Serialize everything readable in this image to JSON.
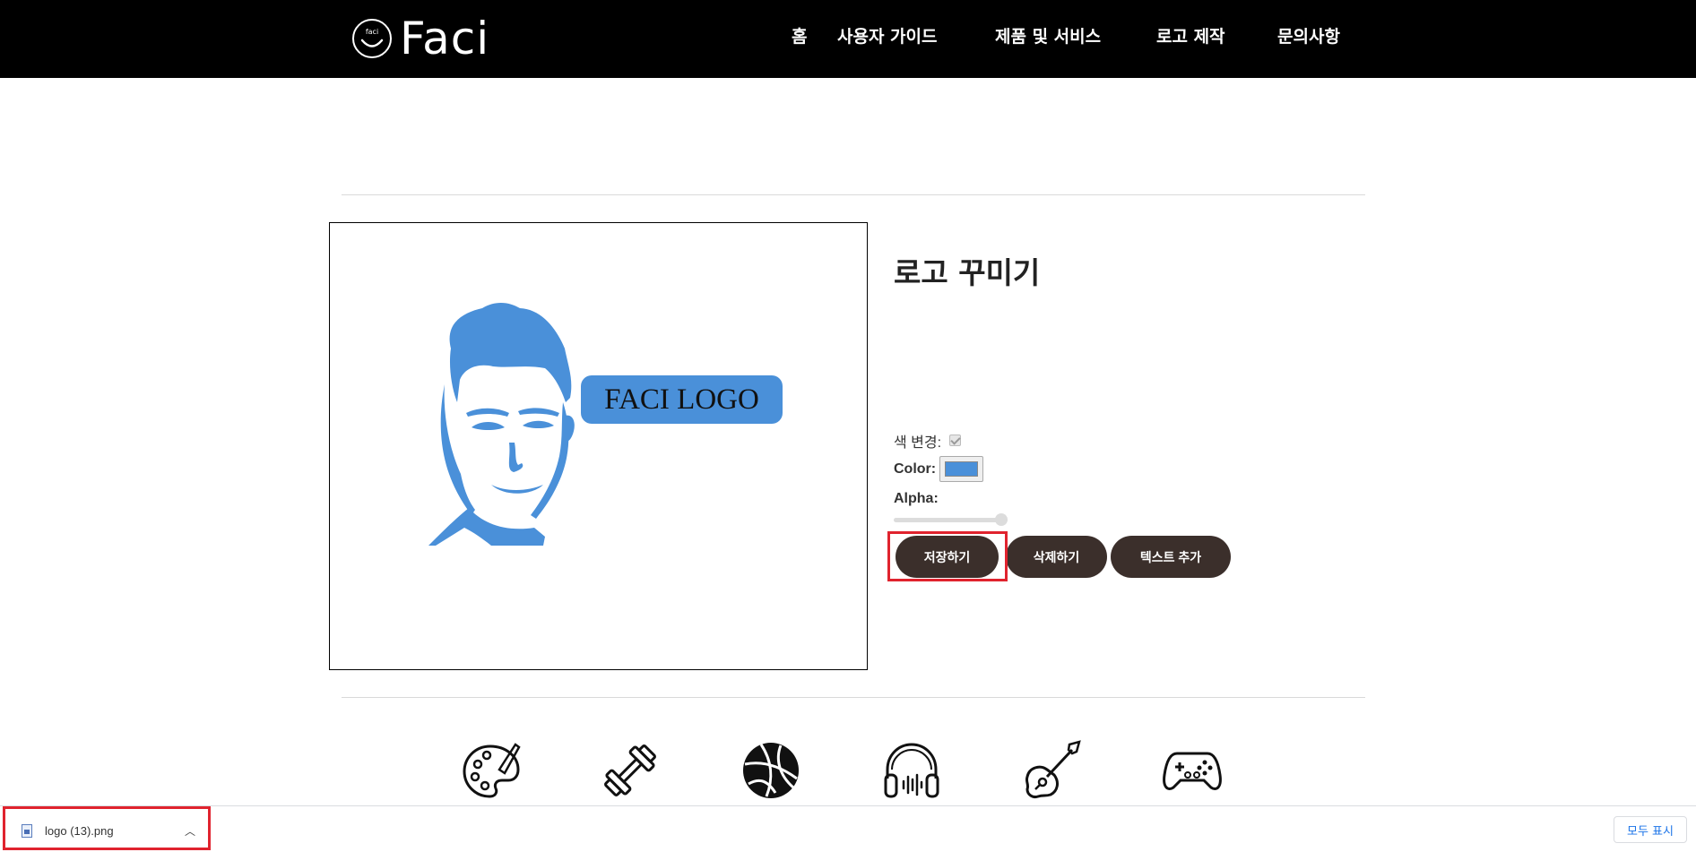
{
  "header": {
    "brand": "Faci",
    "nav": [
      {
        "label": "홈"
      },
      {
        "label": "사용자 가이드"
      },
      {
        "label": "제품 및 서비스"
      },
      {
        "label": "로고 제작"
      },
      {
        "label": "문의사항"
      }
    ]
  },
  "canvas": {
    "bubble_text": "FACI LOGO",
    "logo_color": "#4a90d9"
  },
  "panel": {
    "title": "로고 꾸미기",
    "color_change_label": "색 변경:",
    "color_change_checked": true,
    "color_label": "Color:",
    "color_value": "#4a90d9",
    "alpha_label": "Alpha:",
    "alpha_value": 1.0,
    "buttons": {
      "save": "저장하기",
      "delete": "삭제하기",
      "add_text": "텍스트 추가"
    }
  },
  "icons": [
    "palette-icon",
    "dumbbell-icon",
    "basketball-icon",
    "headphones-icon",
    "guitar-icon",
    "gamepad-icon"
  ],
  "download_bar": {
    "file_name": "logo (13).png",
    "show_all": "모두 표시"
  },
  "colors": {
    "header_bg": "#000000",
    "button_bg": "#3b2f2b",
    "highlight": "#e0232e",
    "accent": "#4a90d9"
  }
}
